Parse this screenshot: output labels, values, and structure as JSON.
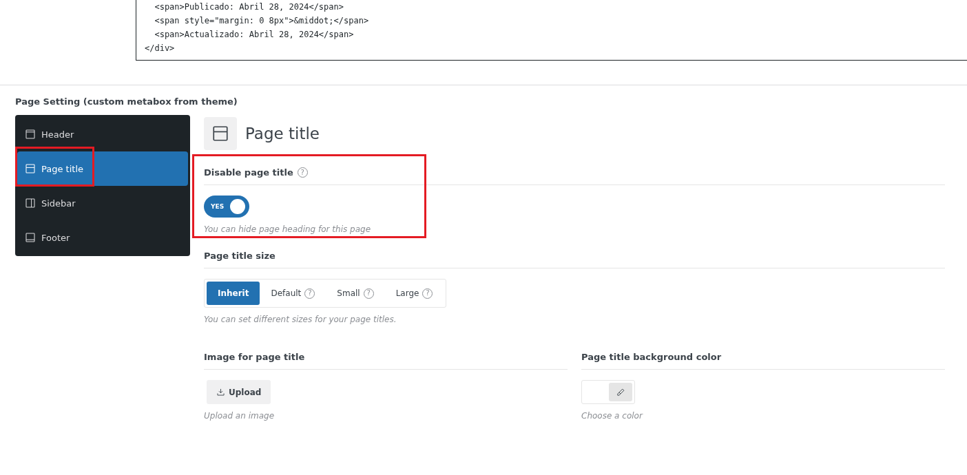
{
  "code_block": {
    "lines": [
      {
        "children": [
          {
            "text": "<span>Publicado: Abril 28, 2024</span>"
          },
          {
            "text": "<span style=\"margin: 0 8px\">&middot;</span>"
          },
          {
            "text": "<span>Actualizado: Abril 28, 2024</span>"
          }
        ]
      },
      {
        "text": "</div>"
      }
    ]
  },
  "metabox": {
    "title": "Page Setting (custom metabox from theme)",
    "sidebar": {
      "items": [
        {
          "label": "Header",
          "selected": false
        },
        {
          "label": "Page title",
          "selected": true,
          "highlighted": true
        },
        {
          "label": "Sidebar",
          "selected": false
        },
        {
          "label": "Footer",
          "selected": false
        }
      ]
    },
    "panel": {
      "title": "Page title",
      "fields": [
        {
          "kind": "switch",
          "label": "Disable page title",
          "help": "?",
          "on": true,
          "switch_text": "YES",
          "description": "You can hide page heading for this page",
          "highlighted": true
        },
        {
          "kind": "buttonset",
          "label": "Page title size",
          "options": [
            {
              "label": "Inherit",
              "selected": true
            },
            {
              "label": "Default",
              "help": "?",
              "selected": false
            },
            {
              "label": "Small",
              "help": "?",
              "selected": false
            },
            {
              "label": "Large",
              "help": "?",
              "selected": false
            }
          ],
          "description": "You can set different sizes for your page titles."
        }
      ],
      "columns": [
        {
          "kind": "upload",
          "label": "Image for page title",
          "button": "Upload",
          "description": "Upload an image"
        },
        {
          "kind": "color",
          "label": "Page title background color",
          "description": "Choose a color"
        }
      ]
    }
  }
}
